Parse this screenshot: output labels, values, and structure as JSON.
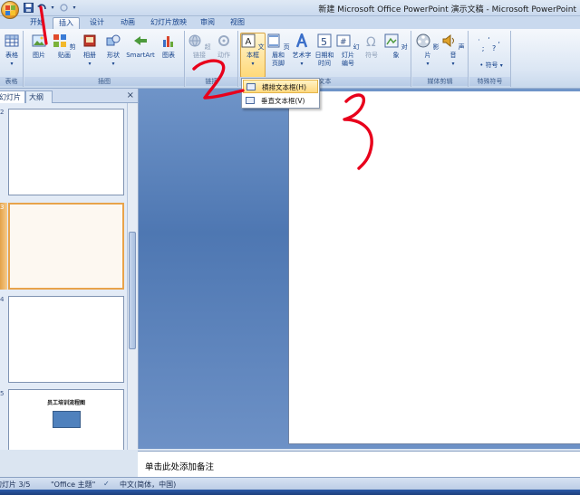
{
  "window": {
    "title": "新建 Microsoft Office PowerPoint 演示文稿 - Microsoft PowerPoint"
  },
  "quick_access": {
    "save_icon": "save-icon",
    "undo_icon": "undo-icon",
    "redo_icon": "redo-icon",
    "customize_icon": "chevron-down-icon"
  },
  "tabs": [
    "开始",
    "插入",
    "设计",
    "动画",
    "幻灯片放映",
    "审阅",
    "视图"
  ],
  "active_tab": "插入",
  "ribbon": {
    "groups": {
      "tables": "表格",
      "illustrations": "插图",
      "links": "链接",
      "text": "文本",
      "media": "媒体剪辑",
      "special_symbols": "特殊符号"
    },
    "buttons": {
      "table": "表格",
      "picture": "图片",
      "clipart": "剪贴画",
      "album": "相册",
      "shapes": "形状",
      "smartart": "SmartArt",
      "chart": "图表",
      "hyperlink": "超链接",
      "action": "动作",
      "textbox": "文本框",
      "header_footer": [
        "页眉和",
        "页脚"
      ],
      "wordart": "艺术字",
      "datetime": [
        "日期和",
        "时间"
      ],
      "slide_number": [
        "幻灯片",
        "编号"
      ],
      "symbol": "符号",
      "object": "对象",
      "movie": "影片",
      "sound": "声音",
      "special_symbol": "符号"
    }
  },
  "textbox_menu": {
    "items": [
      "横排文本框(H)",
      "垂直文本框(V)"
    ],
    "highlighted": 0
  },
  "panel": {
    "tabs": [
      "幻灯片",
      "大纲"
    ],
    "close": "×"
  },
  "thumbnails": [
    {
      "number": "2"
    },
    {
      "number": "3",
      "selected": true
    },
    {
      "number": "4"
    },
    {
      "number": "5",
      "title": "员工培训流程图"
    }
  ],
  "notes": {
    "placeholder": "单击此处添加备注"
  },
  "status": {
    "slide": "幻灯片 3/5",
    "theme": "\"Office 主题\"",
    "language": "中文(简体，中国)"
  },
  "annotations": {
    "marks": [
      "1",
      "2",
      "3"
    ],
    "color": "#e8001b"
  },
  "colors": {
    "ribbon_text": "#15428b",
    "canvas": "#5b82bb",
    "selection": "#e8a34b"
  }
}
